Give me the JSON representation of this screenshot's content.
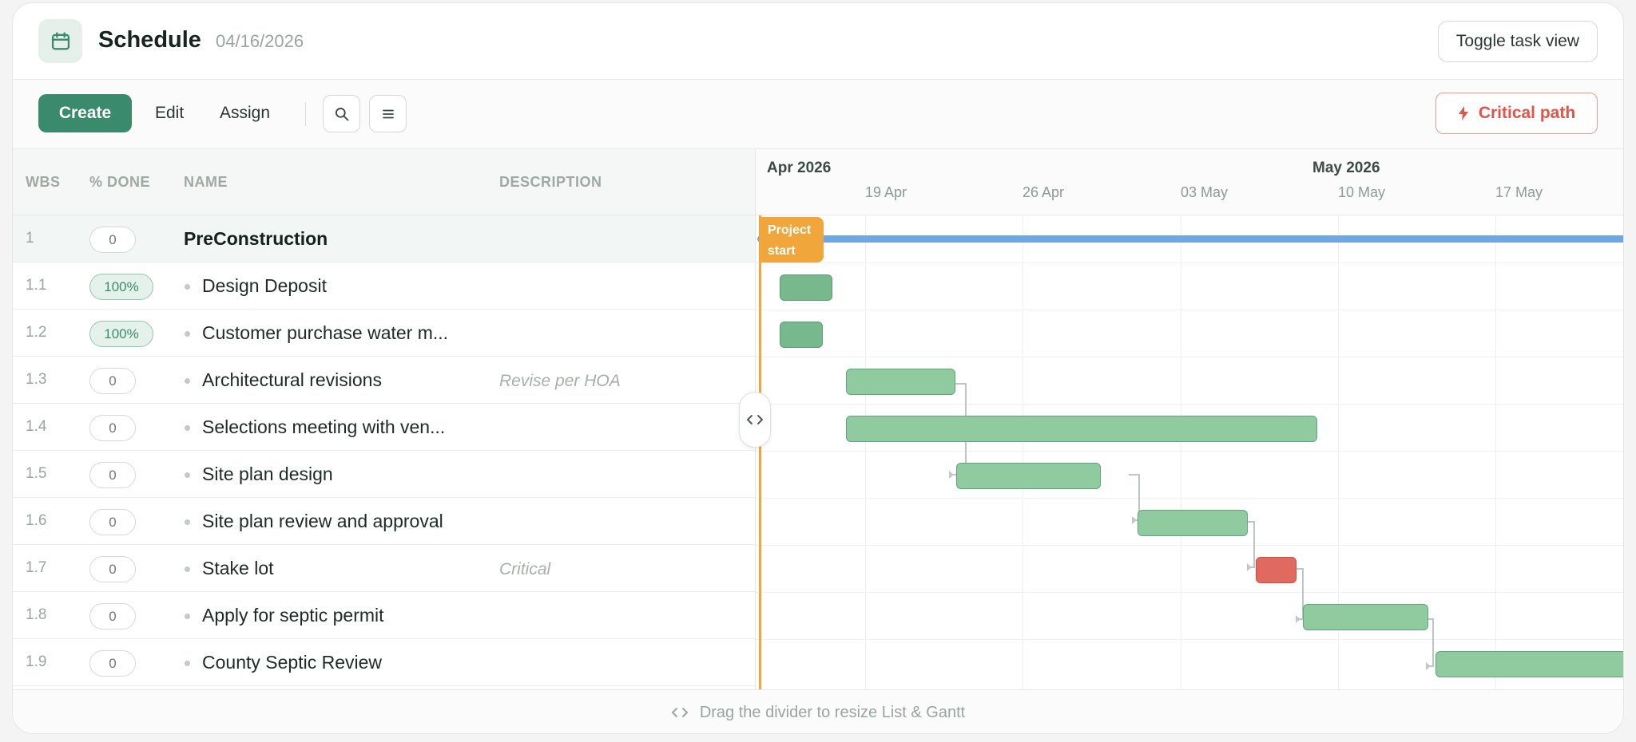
{
  "header": {
    "title": "Schedule",
    "date": "04/16/2026",
    "toggle_label": "Toggle task view",
    "icon": "calendar-icon"
  },
  "toolbar": {
    "create_label": "Create",
    "edit_label": "Edit",
    "assign_label": "Assign",
    "search_icon": "search-icon",
    "menu_icon": "menu-icon",
    "critical_label": "Critical path",
    "critical_icon": "lightning-icon"
  },
  "list": {
    "columns": [
      "WBS",
      "% DONE",
      "NAME",
      "DESCRIPTION"
    ],
    "rows": [
      {
        "wbs": "1",
        "done": "0",
        "name": "PreConstruction",
        "desc": "",
        "summary": true
      },
      {
        "wbs": "1.1",
        "done": "100%",
        "name": "Design Deposit",
        "desc": ""
      },
      {
        "wbs": "1.2",
        "done": "100%",
        "name": "Customer purchase water m...",
        "desc": ""
      },
      {
        "wbs": "1.3",
        "done": "0",
        "name": "Architectural revisions",
        "desc": "Revise per HOA"
      },
      {
        "wbs": "1.4",
        "done": "0",
        "name": "Selections meeting with ven...",
        "desc": ""
      },
      {
        "wbs": "1.5",
        "done": "0",
        "name": "Site plan design",
        "desc": ""
      },
      {
        "wbs": "1.6",
        "done": "0",
        "name": "Site plan review and approval",
        "desc": ""
      },
      {
        "wbs": "1.7",
        "done": "0",
        "name": "Stake lot",
        "desc": "Critical"
      },
      {
        "wbs": "1.8",
        "done": "0",
        "name": "Apply for septic permit",
        "desc": ""
      },
      {
        "wbs": "1.9",
        "done": "0",
        "name": "County Septic Review",
        "desc": ""
      }
    ]
  },
  "gantt": {
    "months": [
      "Apr 2026",
      "May 2026"
    ],
    "weeks": [
      "19 Apr",
      "26 Apr",
      "03 May",
      "10 May",
      "17 May"
    ],
    "start_flag_line1": "Project",
    "start_flag_line2": "start"
  },
  "footer": {
    "hint": "Drag the divider to resize List & Gantt",
    "icon": "resize-arrows-icon"
  },
  "colors": {
    "accent": "#3a8a6e",
    "critical": "#e0544a",
    "summary_bar": "#6fa6e4",
    "milestone": "#f0a63a",
    "task_bar": "#8fcb9f"
  }
}
